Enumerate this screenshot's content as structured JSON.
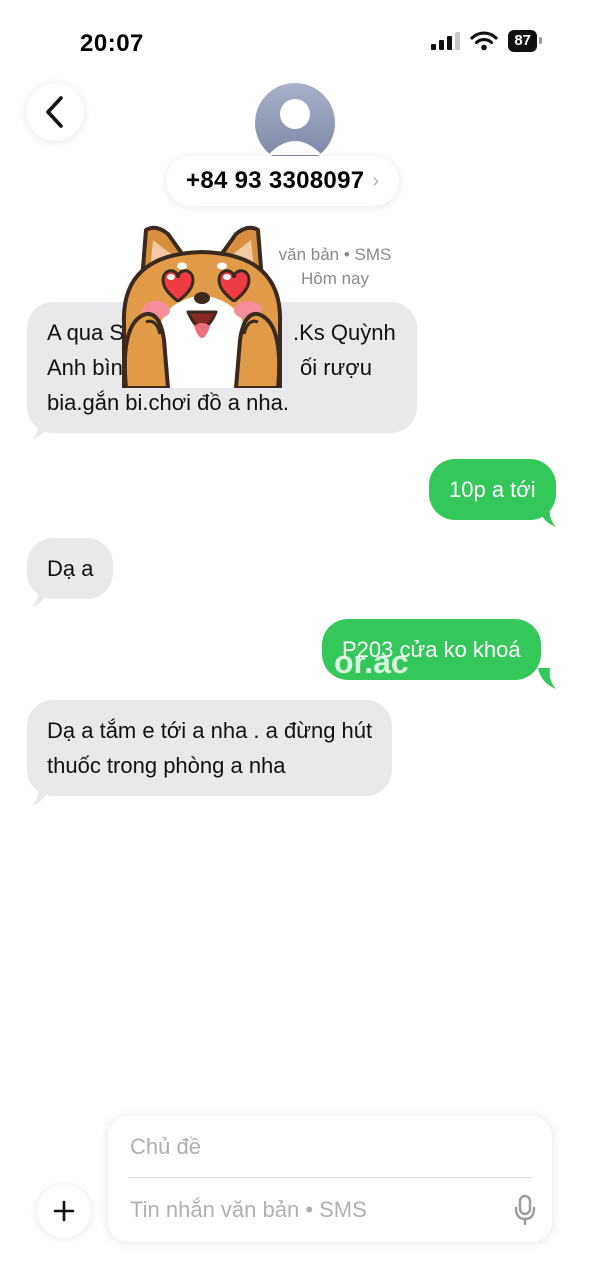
{
  "status_bar": {
    "time": "20:07",
    "battery": "87"
  },
  "header": {
    "contact": "+84 93 3308097",
    "chevron": "›"
  },
  "thread_info": {
    "line1": "văn bản • SMS",
    "line2": "Hôm nay"
  },
  "messages": [
    {
      "direction": "in",
      "lines": [
        "A qua S",
        ".Ks Quỳnh",
        "Anh bìn",
        "ối rượu",
        "bia.gắn bi.chơi đồ a nha."
      ]
    },
    {
      "direction": "out",
      "text": "10p a tới"
    },
    {
      "direction": "in",
      "text": "Dạ a"
    },
    {
      "direction": "out",
      "text": "P203 cửa ko khoá"
    },
    {
      "direction": "in",
      "lines": [
        "Dạ a tắm e tới a nha . a đừng hút",
        "thuốc trong phòng a nha"
      ]
    }
  ],
  "watermark": "or.ac",
  "compose": {
    "subject_placeholder": "Chủ đề",
    "message_placeholder": "Tin nhắn văn bản • SMS"
  },
  "icons": {
    "back": "chevron-left-icon",
    "avatar": "person-icon",
    "signal": "signal-icon",
    "wifi": "wifi-icon",
    "battery": "battery-icon",
    "plus": "plus-icon",
    "mic": "microphone-icon",
    "sticker": "shiba-dog-heart-eyes-sticker"
  },
  "colors": {
    "outgoing": "#34c759",
    "incoming": "#e9e9eb",
    "secondary_text": "#8a8a8e"
  }
}
